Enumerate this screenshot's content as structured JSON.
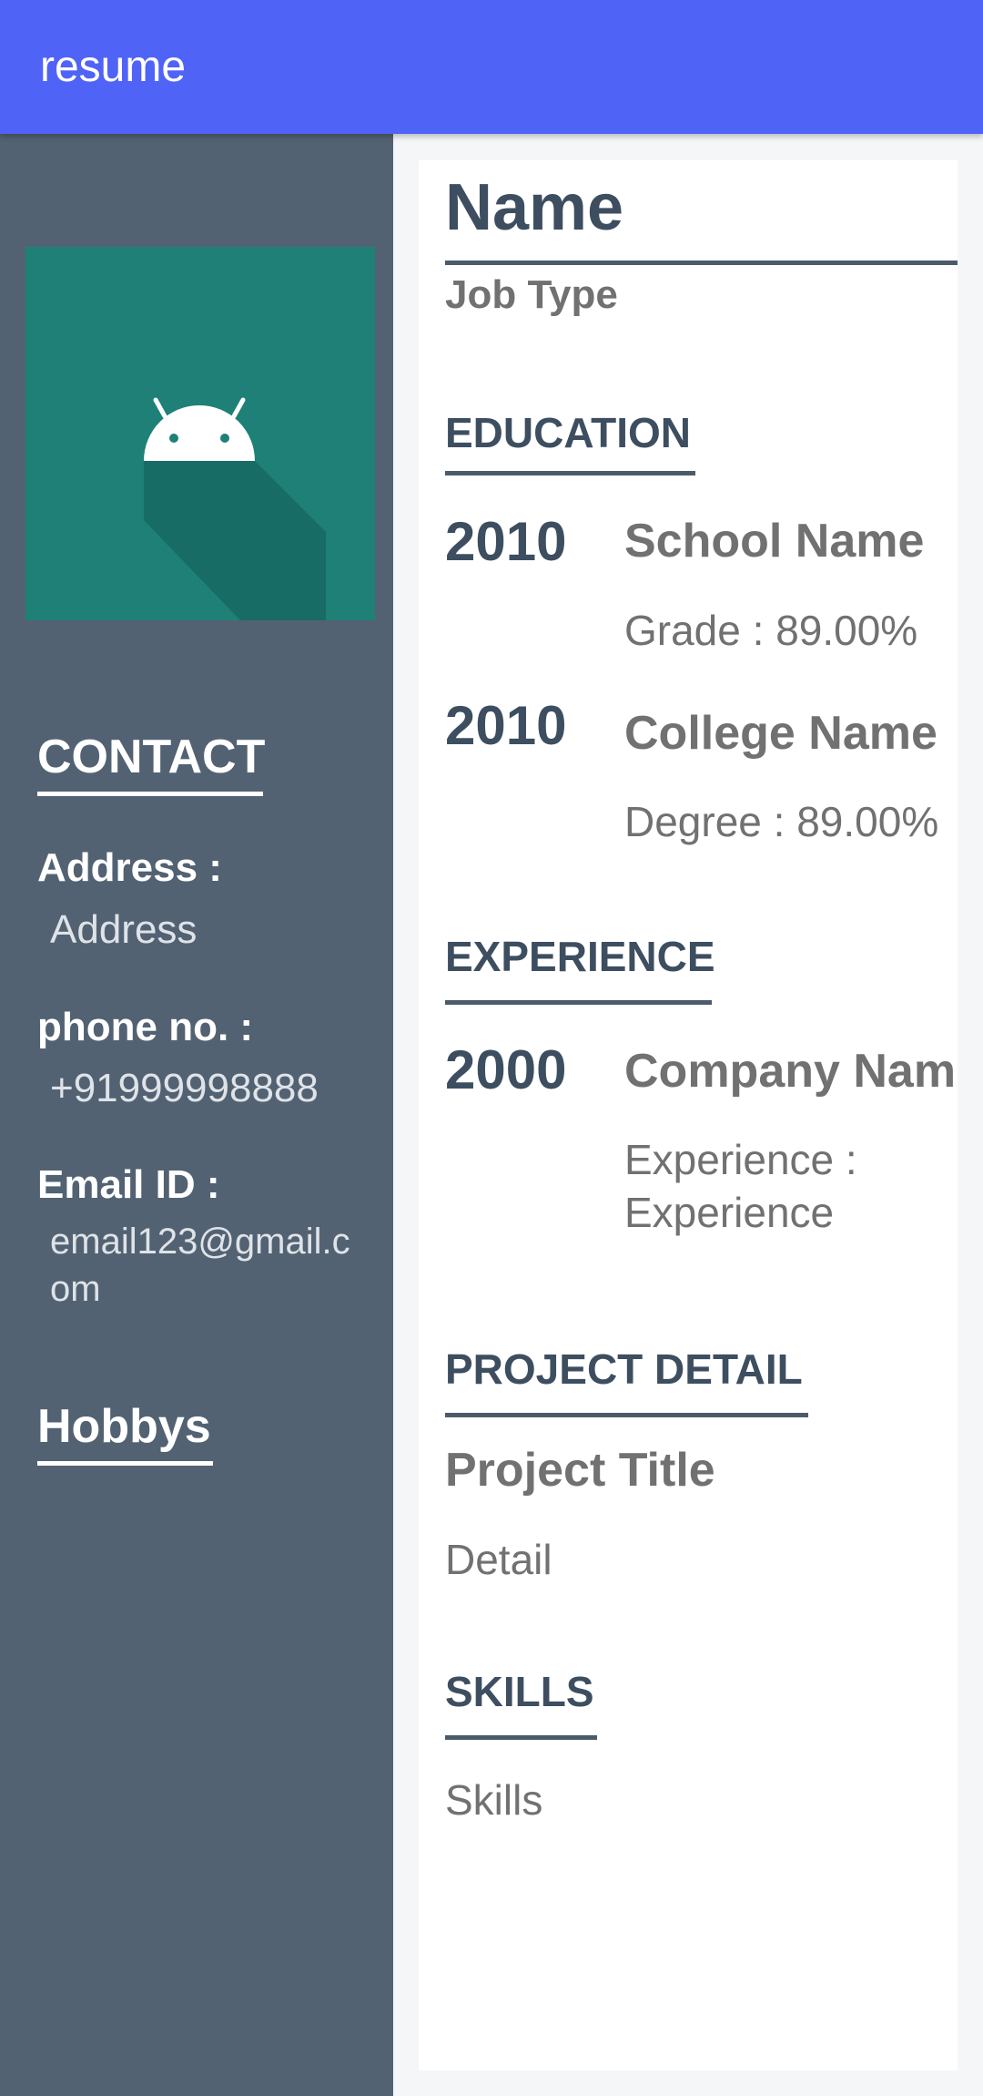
{
  "appbar": {
    "title": "resume"
  },
  "sidebar": {
    "avatar_icon": "android-logo-icon",
    "contact_heading": "CONTACT",
    "address_label": "Address :",
    "address_value": "Address",
    "phone_label": "phone no. :",
    "phone_value": "+91999998888",
    "email_label": "Email ID :",
    "email_value": "email123@gmail.com",
    "hobbies_heading": "Hobbys"
  },
  "main": {
    "name": "Name",
    "job_type": "Job Type",
    "education": {
      "heading": "EDUCATION",
      "entries": [
        {
          "year": "2010",
          "title": "School Name",
          "detail": "Grade : 89.00%"
        },
        {
          "year": "2010",
          "title": "College Name",
          "detail": "Degree : 89.00%"
        }
      ]
    },
    "experience": {
      "heading": "EXPERIENCE",
      "entries": [
        {
          "year": "2000",
          "title": "Company Name",
          "detail": "Experience : Experience"
        }
      ]
    },
    "project": {
      "heading": "PROJECT DETAIL",
      "title": "Project Title",
      "detail": "Detail"
    },
    "skills": {
      "heading": "SKILLS",
      "value": "Skills"
    }
  },
  "colors": {
    "appbar": "#5063f7",
    "sidebar": "#526272",
    "avatar_bg": "#1e8077",
    "heading_text": "#3d4e60",
    "body_text": "#717171"
  }
}
